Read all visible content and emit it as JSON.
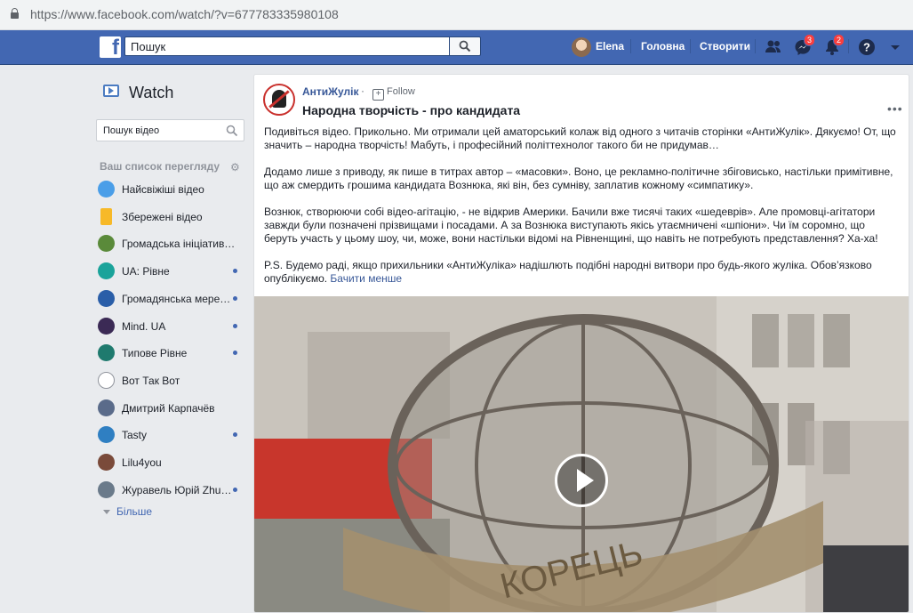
{
  "browser": {
    "url": "https://www.facebook.com/watch/?v=677783335980108"
  },
  "topbar": {
    "search_placeholder": "Пошук",
    "user_name": "Elena",
    "home_label": "Головна",
    "create_label": "Створити",
    "messages_badge": "3",
    "notifications_badge": "2"
  },
  "sidebar": {
    "title": "Watch",
    "search_placeholder": "Пошук відео",
    "list_heading": "Ваш список перегляду",
    "items": [
      {
        "label": "Найсвіжіші відео",
        "icon": "play-circle-icon",
        "color": "#4a9ee8",
        "dot": false
      },
      {
        "label": "Збережені відео",
        "icon": "bookmark-icon",
        "color": "#f7b928",
        "dot": false
      },
      {
        "label": "Громадська ініціатива…",
        "icon": "page-avatar-icon",
        "color": "#5a8a3a",
        "dot": false
      },
      {
        "label": "UA: Рівне",
        "icon": "page-avatar-icon",
        "color": "#1aa39a",
        "dot": true
      },
      {
        "label": "Громадянська мере…",
        "icon": "page-avatar-icon",
        "color": "#2a5ea8",
        "dot": true
      },
      {
        "label": "Mind. UA",
        "icon": "page-avatar-icon",
        "color": "#3b2a55",
        "dot": true
      },
      {
        "label": "Типове Рівне",
        "icon": "page-avatar-icon",
        "color": "#1f7a6e",
        "dot": true
      },
      {
        "label": "Вот Так Вот",
        "icon": "page-avatar-icon",
        "color": "#ffffff",
        "dot": false
      },
      {
        "label": "Дмитрий Карпачёв",
        "icon": "page-avatar-icon",
        "color": "#5a6b8a",
        "dot": false
      },
      {
        "label": "Tasty",
        "icon": "page-avatar-icon",
        "color": "#2f7fc2",
        "dot": true
      },
      {
        "label": "Lilu4you",
        "icon": "page-avatar-icon",
        "color": "#7a4a3a",
        "dot": false
      },
      {
        "label": "Журавель Юрій Zhu…",
        "icon": "page-avatar-icon",
        "color": "#6a7a8a",
        "dot": true
      }
    ],
    "more_label": "Більше"
  },
  "post": {
    "page_name": "АнтиЖулік",
    "separator": "·",
    "follow_label": "Follow",
    "title": "Народна творчість - про кандидата",
    "paragraphs": [
      "Подивіться відео. Прикольно. Ми отримали цей аматорський колаж від одного з читачів сторінки «АнтиЖулік». Дякуємо! От, що значить – народна творчість! Мабуть, і професійний політтехнолог такого би не придумав…",
      "Додамо лише з приводу, як пише в титрах автор – «масовки». Воно, це рекламно-політичне збіговисько, настільки примітивне, що аж смердить грошима кандидата Вознюка, які він, без сумніву, заплатив кожному «симпатику».",
      "Вознюк, створюючи собі відео-агітацію, - не відкрив Америки. Бачили вже тисячі таких «шедеврів». Але промовці-агітатори завжди були позначені прізвищами і посадами. А за Вознюка виступають якісь утаємничені «шпіони». Чи їм соромно, що беруть участь у цьому шоу, чи, може, вони настільки відомі на Рівненщині, що навіть не потребують представлення? Ха-ха!"
    ],
    "last_paragraph": "P.S. Будемо раді, якщо прихильники «АнтиЖуліка» надішлють подібні народні витвори про будь-якого жуліка. Обов’язково опублікуємо.",
    "see_less_label": "Бачити менше",
    "video_sign_text": "КОРЕЦЬ"
  }
}
